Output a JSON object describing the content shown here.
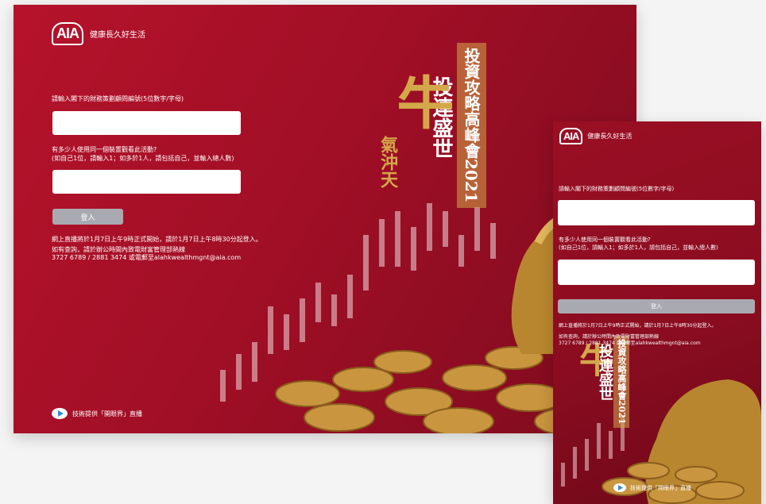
{
  "brand": {
    "logo_text": "AIA",
    "tagline": "健康長久好生活"
  },
  "form": {
    "advisor_label": "請輸入閣下的財務策劃顧問編號(5位數字/字母)",
    "advisor_value": "",
    "viewers_label_line1": "有多少人使用同一個裝置觀看此活動?",
    "viewers_label_line2": "(如自己1位，請輸入1；如多於1人，請包括自己，並輸入總人數)",
    "viewers_value": "",
    "login_label": "登入"
  },
  "info": {
    "notice": "網上直播將於1月7日上午9時正式開始，請於1月7日上午8時30分起登入。",
    "contact_line1": "如有查詢，請於辦公時間內致電財富管理部熱線",
    "contact_line2": "3727 6789 / 2881 3474 或電郵至alahkwealthmgnt@aia.com"
  },
  "footer": {
    "provider": "技術提供「開眼界」直播"
  },
  "hero": {
    "event_title": "投資攻略高峰會2021",
    "headline": "投連盛世",
    "calligraphy_big": "牛",
    "calligraphy_small": "氣沖天"
  },
  "colors": {
    "background": "#a8112a",
    "button": "#a9aab1",
    "gold": "#d4a84a"
  }
}
